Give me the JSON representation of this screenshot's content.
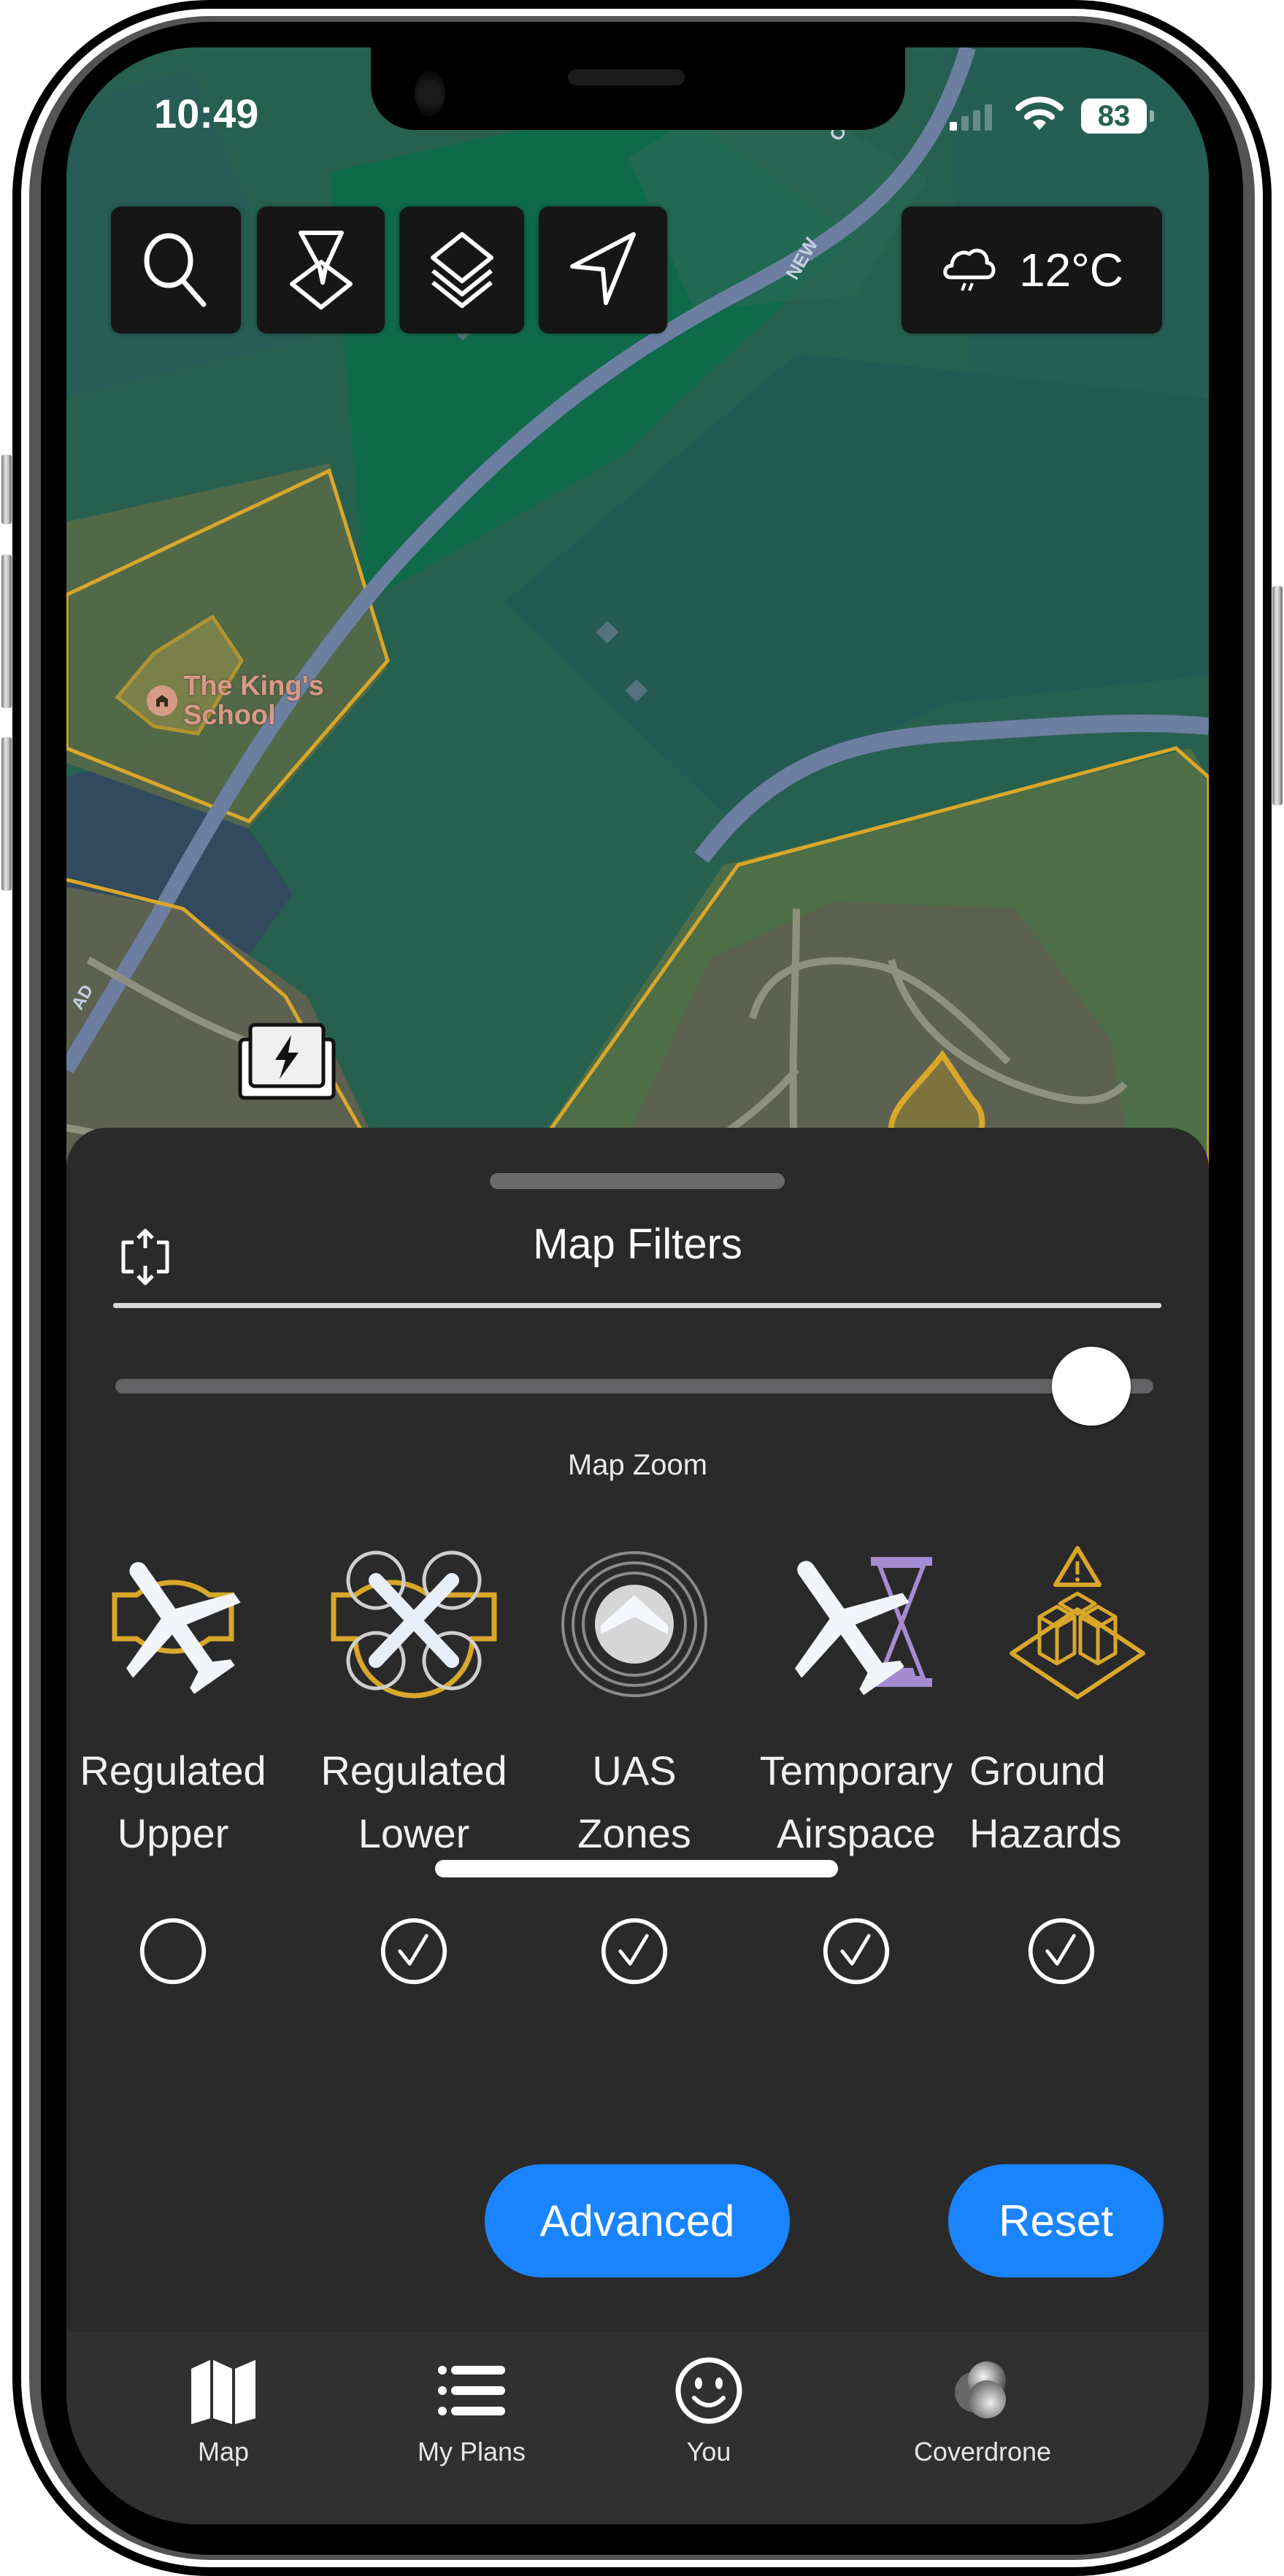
{
  "status_bar": {
    "time": "10:49",
    "battery": "83",
    "signal_icon": "cellular-signal-icon",
    "wifi_icon": "wifi-icon"
  },
  "map": {
    "toolbar": [
      {
        "name": "search",
        "icon": "search-icon"
      },
      {
        "name": "drop-pin",
        "icon": "pin-drop-icon"
      },
      {
        "name": "layers",
        "icon": "layers-icon"
      },
      {
        "name": "locate",
        "icon": "location-arrow-icon"
      }
    ],
    "weather": {
      "icon": "cloud-rain-icon",
      "temperature": "12°C"
    },
    "labels": {
      "school": "The King's School",
      "school_line1": "The King's",
      "school_line2": "School",
      "road_top": "NEW",
      "road_top2": "OAD",
      "road_left": "AD"
    },
    "marker": {
      "icon": "charging-station-icon"
    },
    "colors": {
      "base": "#27604f",
      "forest": "#0f6a4a",
      "zone_outline": "#d9a72a",
      "road": "#6d7fa0",
      "urban": "#5d6150"
    }
  },
  "sheet": {
    "title": "Map Filters",
    "expand_icon": "expand-vertical-icon",
    "slider": {
      "label": "Map Zoom",
      "value": 0.94
    },
    "filters": [
      {
        "line1": "Regulated",
        "line2": "Upper",
        "icon": "regulated-upper-icon",
        "checked": false
      },
      {
        "line1": "Regulated",
        "line2": "Lower",
        "icon": "regulated-lower-icon",
        "checked": true
      },
      {
        "line1": "UAS",
        "line2": "Zones",
        "icon": "uas-zones-icon",
        "checked": true
      },
      {
        "line1": "Temporary",
        "line2": "Airspace",
        "icon": "temporary-airspace-icon",
        "checked": true
      },
      {
        "line1": "Ground",
        "line2": "Hazards",
        "icon": "ground-hazards-icon",
        "checked": true
      }
    ],
    "buttons": {
      "advanced": "Advanced",
      "reset": "Reset"
    },
    "accent": "#1a84ff"
  },
  "tabbar": {
    "items": [
      {
        "label": "Map",
        "icon": "map-icon"
      },
      {
        "label": "My Plans",
        "icon": "list-icon"
      },
      {
        "label": "You",
        "icon": "smiley-icon"
      },
      {
        "label": "Coverdrone",
        "icon": "coverdrone-logo-icon"
      }
    ]
  }
}
